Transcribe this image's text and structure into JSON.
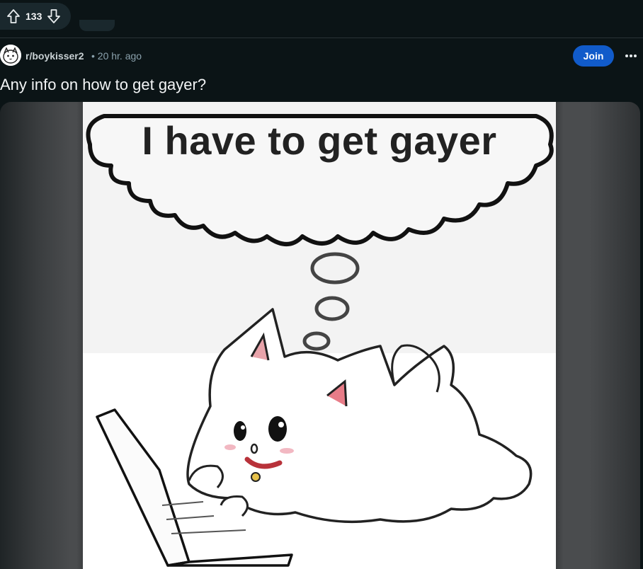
{
  "vote": {
    "count": "133",
    "up_icon": "arrow-up-icon",
    "down_icon": "arrow-down-icon"
  },
  "post": {
    "subreddit": "r/boykisser2",
    "time": "• 20 hr. ago",
    "join_label": "Join",
    "more_icon": "ellipsis-icon",
    "title": "Any info on how to get gayer?"
  },
  "image": {
    "speech_text": "I have to get gayer"
  },
  "colors": {
    "background": "#0b1416",
    "join": "#115bca",
    "pill": "#1a282d"
  }
}
